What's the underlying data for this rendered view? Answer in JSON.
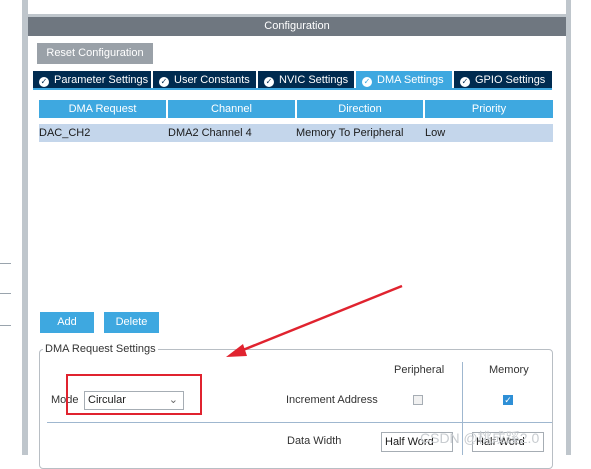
{
  "config_header": {
    "title": "Configuration"
  },
  "reset_button": {
    "label": "Reset Configuration"
  },
  "tabs": [
    {
      "label": "Parameter Settings",
      "active": false
    },
    {
      "label": "User Constants",
      "active": false
    },
    {
      "label": "NVIC Settings",
      "active": false
    },
    {
      "label": "DMA Settings",
      "active": true
    },
    {
      "label": "GPIO Settings",
      "active": false
    }
  ],
  "dma_table": {
    "columns": [
      "DMA Request",
      "Channel",
      "Direction",
      "Priority"
    ],
    "rows": [
      [
        "DAC_CH2",
        "DMA2 Channel 4",
        "Memory To Peripheral",
        "Low"
      ]
    ]
  },
  "buttons": {
    "add": "Add",
    "delete": "Delete"
  },
  "request_settings": {
    "legend": "DMA Request Settings",
    "peripheral_col": "Peripheral",
    "memory_col": "Memory",
    "mode_label": "Mode",
    "mode_value": "Circular",
    "increment_label": "Increment Address",
    "peripheral_increment": false,
    "memory_increment": true,
    "data_width_label": "Data Width",
    "peripheral_data_width": "Half Word",
    "memory_data_width": "Half Word"
  },
  "watermark": "CSDN @桃成蹊2.0",
  "colors": {
    "accent": "#3ea8e0",
    "tab_dark": "#002b50",
    "annotation_red": "#e0232f"
  }
}
